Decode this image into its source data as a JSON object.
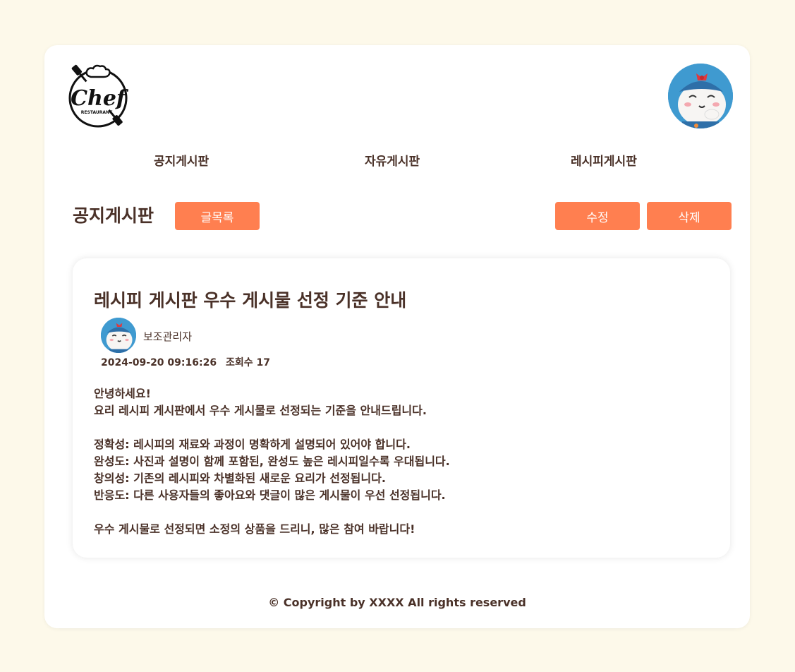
{
  "logo": {
    "text": "Chef",
    "subtext": "RESTAURANT"
  },
  "nav": [
    {
      "label": "공지게시판"
    },
    {
      "label": "자유게시판"
    },
    {
      "label": "레시피게시판"
    }
  ],
  "board": {
    "title": "공지게시판",
    "list_label": "글목록",
    "edit_label": "수정",
    "delete_label": "삭제"
  },
  "post": {
    "title": "레시피 게시판 우수 게시물 선정 기준 안내",
    "author": "보조관리자",
    "datetime": "2024-09-20 09:16:26",
    "views": "조회수 17",
    "lines": [
      "안녕하세요!",
      "요리 레시피 게시판에서 우수 게시물로 선정되는 기준을 안내드립니다.",
      "",
      "정확성: 레시피의 재료와 과정이 명확하게 설명되어 있어야 합니다.",
      "완성도: 사진과 설명이 함께 포함된, 완성도 높은 레시피일수록 우대됩니다.",
      "창의성: 기존의 레시피와 차별화된 새로운 요리가 선정됩니다.",
      "반응도: 다른 사용자들의 좋아요와 댓글이 많은 게시물이 우선 선정됩니다.",
      "",
      "우수 게시물로 선정되면 소정의 상품을 드리니, 많은 참여 바랍니다!"
    ]
  },
  "footer": {
    "copyright": "© Copyright by XXXX All rights reserved"
  },
  "colors": {
    "background": "#fdf9ea",
    "accent": "#ff7f50",
    "text": "#4a3128",
    "avatar_bg": "#3f9ad0"
  }
}
